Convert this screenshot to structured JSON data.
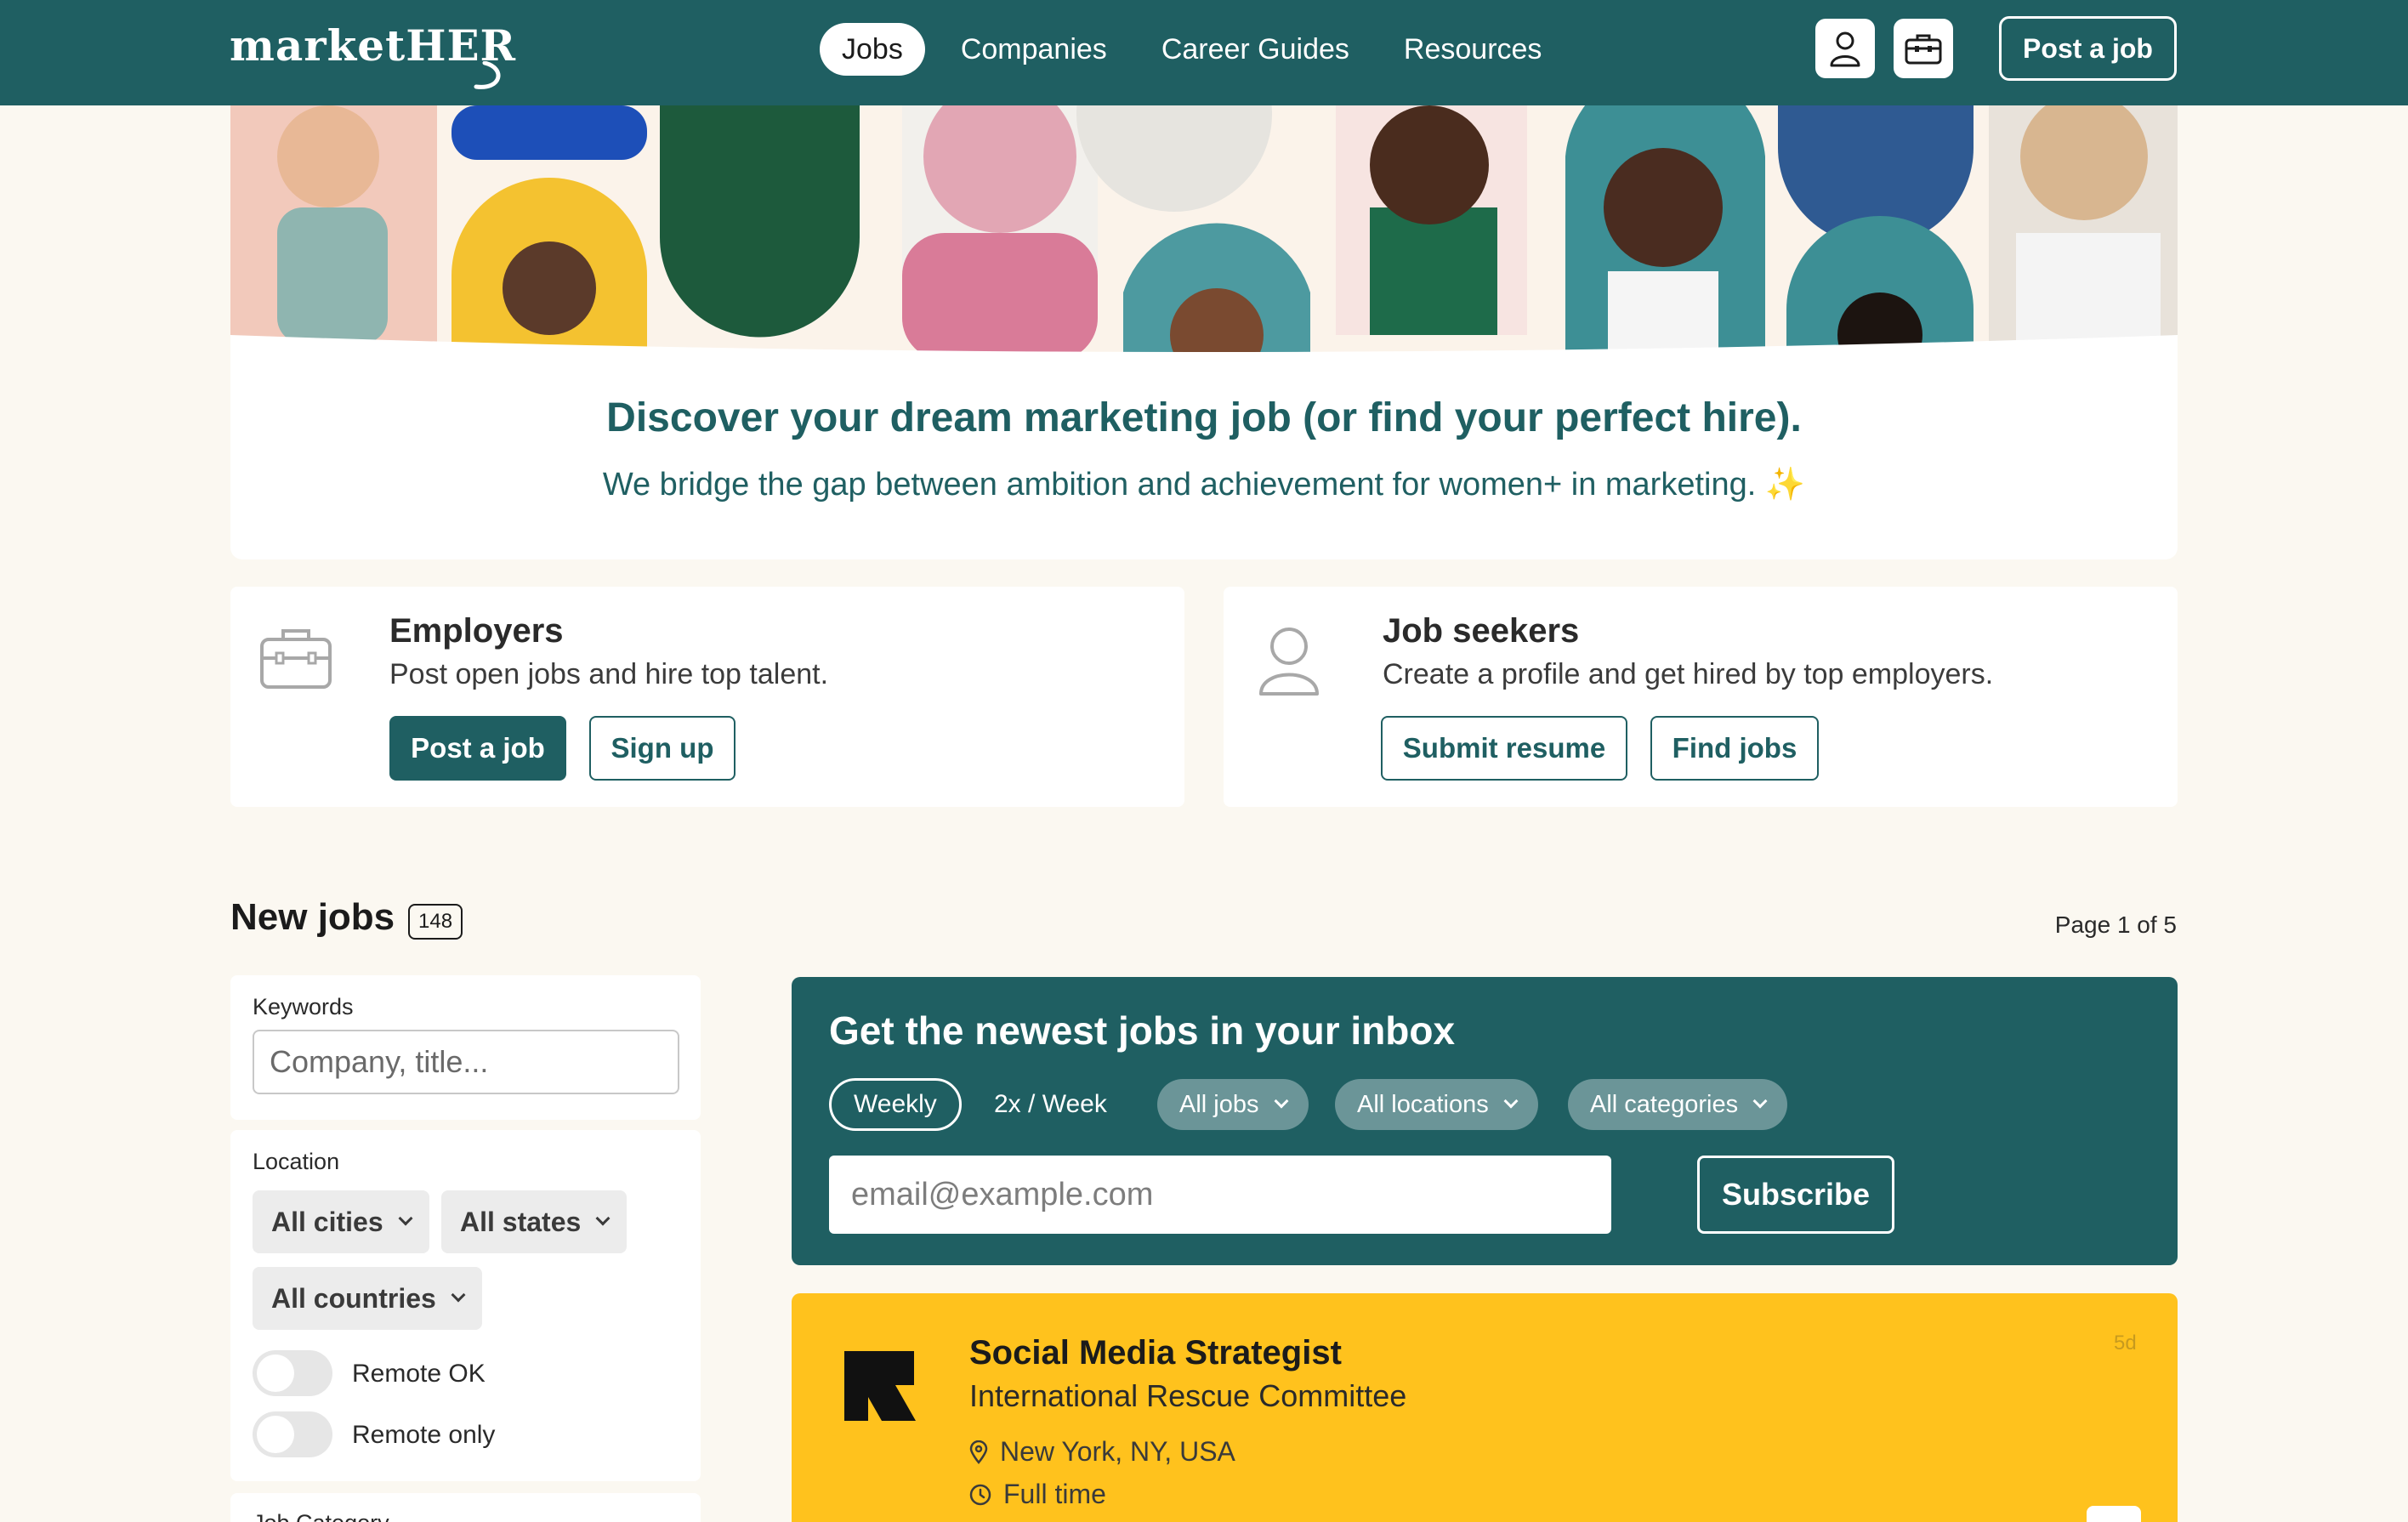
{
  "nav": {
    "logo": "marketHER",
    "links": [
      "Jobs",
      "Companies",
      "Career Guides",
      "Resources"
    ],
    "account_icon": "person-icon",
    "employer_icon": "briefcase-icon",
    "post_job": "Post a job"
  },
  "hero": {
    "title": "Discover your dream marketing job (or find your perfect hire).",
    "subtitle": "We bridge the gap between ambition and achievement for women+ in marketing. ✨"
  },
  "employers": {
    "title": "Employers",
    "desc": "Post open jobs and hire top talent.",
    "primary": "Post a job",
    "secondary": "Sign up",
    "icon": "briefcase-icon"
  },
  "seekers": {
    "title": "Job seekers",
    "desc": "Create a profile and get hired by top employers.",
    "primary": "Submit resume",
    "secondary": "Find jobs",
    "icon": "person-icon"
  },
  "jobs_header": {
    "title": "New jobs",
    "count": "148",
    "page": "Page 1 of 5"
  },
  "filters": {
    "keywords_label": "Keywords",
    "keywords_placeholder": "Company, title...",
    "location_label": "Location",
    "cities": "All cities",
    "states": "All states",
    "countries": "All countries",
    "remote_ok": "Remote OK",
    "remote_only": "Remote only",
    "category_label": "Job Category"
  },
  "newsletter": {
    "title": "Get the newest jobs in your inbox",
    "freq_weekly": "Weekly",
    "freq_2x": "2x / Week",
    "dd_jobs": "All jobs",
    "dd_locations": "All locations",
    "dd_categories": "All categories",
    "email_placeholder": "email@example.com",
    "subscribe": "Subscribe"
  },
  "job": {
    "title": "Social Media Strategist",
    "company": "International Rescue Committee",
    "location": "New York, NY, USA",
    "type": "Full time",
    "age": "5d"
  },
  "colors": {
    "brand_teal": "#1f5f62",
    "page_bg": "#fbf8f1",
    "featured_yellow": "#ffc21d"
  }
}
